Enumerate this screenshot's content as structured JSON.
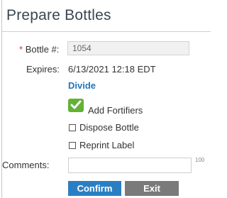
{
  "dialog": {
    "title": "Prepare Bottles"
  },
  "form": {
    "bottle_label_required": "*",
    "bottle_label": "Bottle #:",
    "bottle_value": "1054",
    "expires_label": "Expires:",
    "expires_value": "6/13/2021 12:18 EDT",
    "divide_link": "Divide",
    "add_fortifiers_label": "Add Fortifiers",
    "add_fortifiers_checked": true,
    "dispose_bottle_label": "Dispose Bottle",
    "dispose_bottle_checked": false,
    "reprint_label_label": "Reprint Label",
    "reprint_label_checked": false,
    "comments_label": "Comments:",
    "comments_value": "",
    "comments_max": "100"
  },
  "buttons": {
    "confirm": "Confirm",
    "exit": "Exit"
  },
  "colors": {
    "accent": "#2a7fc3",
    "link": "#2375b8",
    "checked": "#62b234",
    "required": "#d9342b",
    "exit": "#7a7a7a"
  }
}
